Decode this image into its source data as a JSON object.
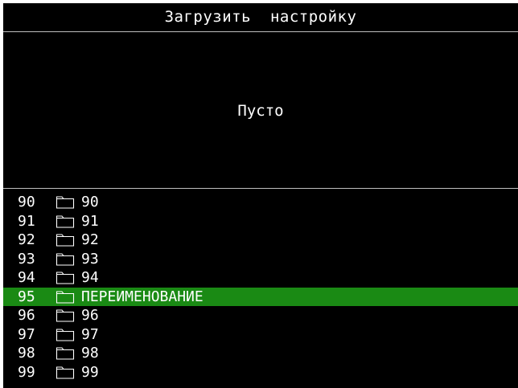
{
  "header": {
    "title": "Загрузить  настройку"
  },
  "preview": {
    "text": "Пусто"
  },
  "list": {
    "selected_index": 5,
    "folder_icon": "folder-icon",
    "items": [
      {
        "number": "90",
        "name": "90"
      },
      {
        "number": "91",
        "name": "91"
      },
      {
        "number": "92",
        "name": "92"
      },
      {
        "number": "93",
        "name": "93"
      },
      {
        "number": "94",
        "name": "94"
      },
      {
        "number": "95",
        "name": "ПЕРЕИМЕНОВАНИЕ"
      },
      {
        "number": "96",
        "name": "96"
      },
      {
        "number": "97",
        "name": "97"
      },
      {
        "number": "98",
        "name": "98"
      },
      {
        "number": "99",
        "name": "99"
      }
    ]
  },
  "colors": {
    "background": "#000000",
    "text": "#ffffff",
    "selection": "#1a8a14",
    "divider": "#bfbfbf"
  }
}
